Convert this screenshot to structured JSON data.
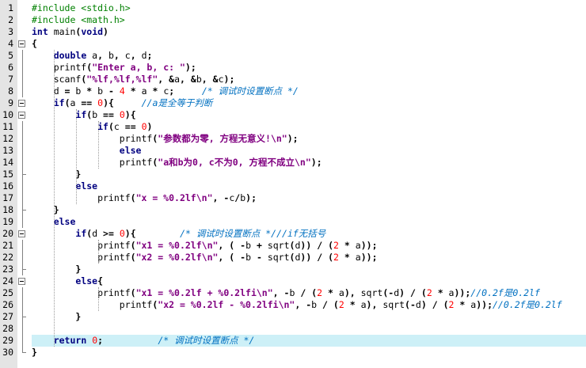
{
  "editor": {
    "lines": [
      {
        "num": "1",
        "text": "#include <stdio.h>"
      },
      {
        "num": "2",
        "text": "#include <math.h>"
      },
      {
        "num": "3",
        "text": "int main(void)"
      },
      {
        "num": "4",
        "text": "{"
      },
      {
        "num": "5",
        "text": "    double a, b, c, d;"
      },
      {
        "num": "6",
        "text": "    printf(\"Enter a, b, c: \");"
      },
      {
        "num": "7",
        "text": "    scanf(\"%lf,%lf,%lf\", &a, &b, &c);"
      },
      {
        "num": "8",
        "text": "    d = b * b - 4 * a * c;     /* 调试时设置断点 */"
      },
      {
        "num": "9",
        "text": "    if(a == 0){     //a是全等于判断"
      },
      {
        "num": "10",
        "text": "        if(b == 0){"
      },
      {
        "num": "11",
        "text": "            if(c == 0)"
      },
      {
        "num": "12",
        "text": "                printf(\"参数都为零, 方程无意义!\\n\");"
      },
      {
        "num": "13",
        "text": "                else"
      },
      {
        "num": "14",
        "text": "                printf(\"a和b为0, c不为0, 方程不成立\\n\");"
      },
      {
        "num": "15",
        "text": "        }"
      },
      {
        "num": "16",
        "text": "        else"
      },
      {
        "num": "17",
        "text": "            printf(\"x = %0.2lf\\n\", -c/b);"
      },
      {
        "num": "18",
        "text": "    }"
      },
      {
        "num": "19",
        "text": "    else"
      },
      {
        "num": "20",
        "text": "        if(d >= 0){        /* 调试时设置断点 *///if无括号"
      },
      {
        "num": "21",
        "text": "            printf(\"x1 = %0.2lf\\n\", ( -b + sqrt(d)) / (2 * a));"
      },
      {
        "num": "22",
        "text": "            printf(\"x2 = %0.2lf\\n\", ( -b - sqrt(d)) / (2 * a));"
      },
      {
        "num": "23",
        "text": "        }"
      },
      {
        "num": "24",
        "text": "        else{"
      },
      {
        "num": "25",
        "text": "            printf(\"x1 = %0.2lf + %0.2lfi\\n\", -b / (2 * a), sqrt(-d) / (2 * a));//0.2f是0.2lf"
      },
      {
        "num": "26",
        "text": "                printf(\"x2 = %0.2lf - %0.2lfi\\n\", -b / (2 * a), sqrt(-d) / (2 * a));//0.2f是0.2lf"
      },
      {
        "num": "27",
        "text": "        }"
      },
      {
        "num": "28",
        "text": ""
      },
      {
        "num": "29",
        "text": "    return 0;          /* 调试时设置断点 */"
      },
      {
        "num": "30",
        "text": "}"
      }
    ],
    "highlighted_line": "29",
    "colors": {
      "keyword": "#000080",
      "preprocessor": "#008000",
      "string": "#800080",
      "comment": "#0070c0",
      "number": "#ff0000",
      "operator": "#000000",
      "highlight": "#cdf0f7",
      "gutter": "#e4e4e4"
    }
  }
}
